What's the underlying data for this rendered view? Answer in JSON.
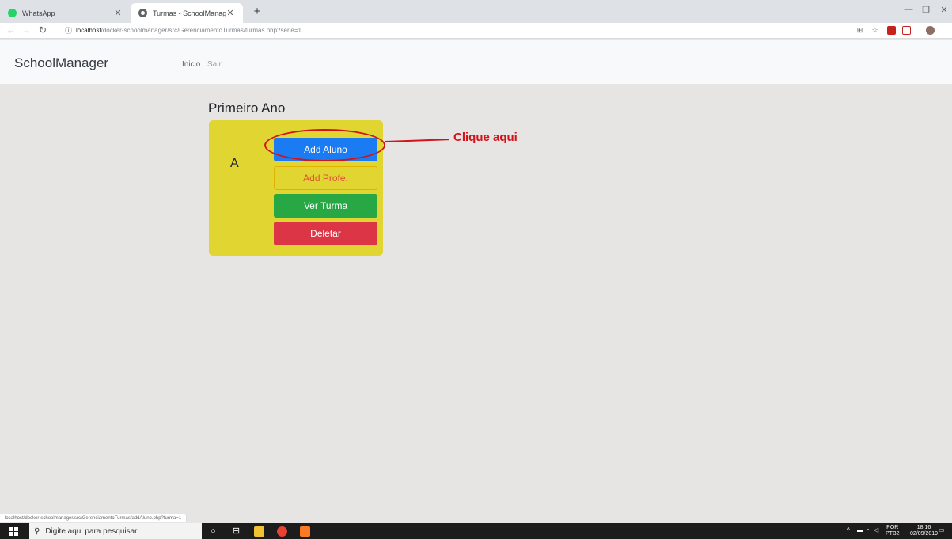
{
  "browser": {
    "tabs": [
      {
        "title": "WhatsApp",
        "icon": "whatsapp-icon"
      },
      {
        "title": "Turmas - SchoolManager",
        "icon": "globe-icon"
      }
    ],
    "url_host": "localhost",
    "url_path": "/docker-schoolmanager/src/GerenciamentoTurmas/turmas.php?serie=1",
    "status_url": "localhost/docker-schoolmanager/src/GerenciamentoTurmas/addAluno.php?turma=1"
  },
  "navbar": {
    "brand": "SchoolManager",
    "home_link": "Inicio",
    "logout_link": "Sair"
  },
  "page": {
    "title": "Primeiro Ano",
    "class_card": {
      "name": "A",
      "add_student": "Add Aluno",
      "add_teacher": "Add Profe.",
      "view_class": "Ver Turma",
      "delete": "Deletar",
      "card_color": "#e0d531"
    },
    "annotation": "Clique aqui",
    "annotation_color": "#d31319"
  },
  "taskbar": {
    "search_placeholder": "Digite aqui para pesquisar",
    "lang_top": "POR",
    "lang_bottom": "PTB2",
    "time": "18:16",
    "date": "02/09/2019"
  }
}
